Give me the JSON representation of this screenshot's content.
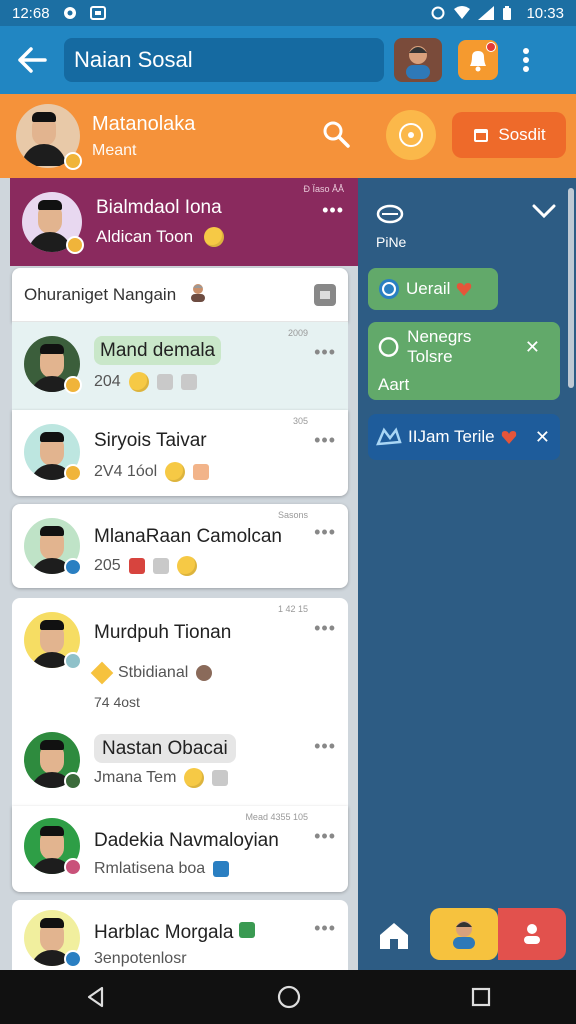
{
  "status_bar": {
    "time_left": "12:68",
    "time_right": "10:33"
  },
  "app_bar": {
    "title": "Naian Sosal"
  },
  "orange_bar": {
    "name": "Matanolaka",
    "subtitle": "Meant",
    "action_label": "Sosdit"
  },
  "pinned_chat": {
    "name": "Bialmdaol Iona",
    "subtitle": "Aldican Toon",
    "meta": "Ð Ïaso ÅÅ"
  },
  "group_header": {
    "title": "Ohuraniget Nangain"
  },
  "chats": [
    {
      "name": "Mand demala",
      "subtitle": "204",
      "meta": "2009"
    },
    {
      "name": "Siryois Taivar",
      "subtitle": "2V4 1óol",
      "meta": "305"
    },
    {
      "name": "MlanaRaan Camolcan",
      "subtitle": "205",
      "meta": "Sasons"
    },
    {
      "name": "Murdpuh Tionan",
      "subtitle": "Stbidianal",
      "sub2_left": "74 4ost",
      "meta": "1 42 15"
    },
    {
      "name": "Nastan Obacai",
      "subtitle": "Jmana Tem",
      "meta": ""
    },
    {
      "name": "Dadekia Navmaloyian",
      "subtitle": "Rmlatisena boa",
      "meta": "Mead 4355 105"
    },
    {
      "name": "Harblac Morgala",
      "subtitle": "3enpotenlosr",
      "meta": ""
    }
  ],
  "right_panel": {
    "label": "PiNe",
    "chips": [
      {
        "label": "Uerail"
      },
      {
        "label": "Nenegrs Tolsre",
        "sub": "Aart"
      },
      {
        "label": "IIJam Terile"
      }
    ]
  },
  "colors": {
    "primary": "#2186c2",
    "orange": "#f5923a",
    "pinned": "#8a2a5e",
    "green_chip": "#62a96a",
    "blue_chip": "#1e5c9b"
  }
}
